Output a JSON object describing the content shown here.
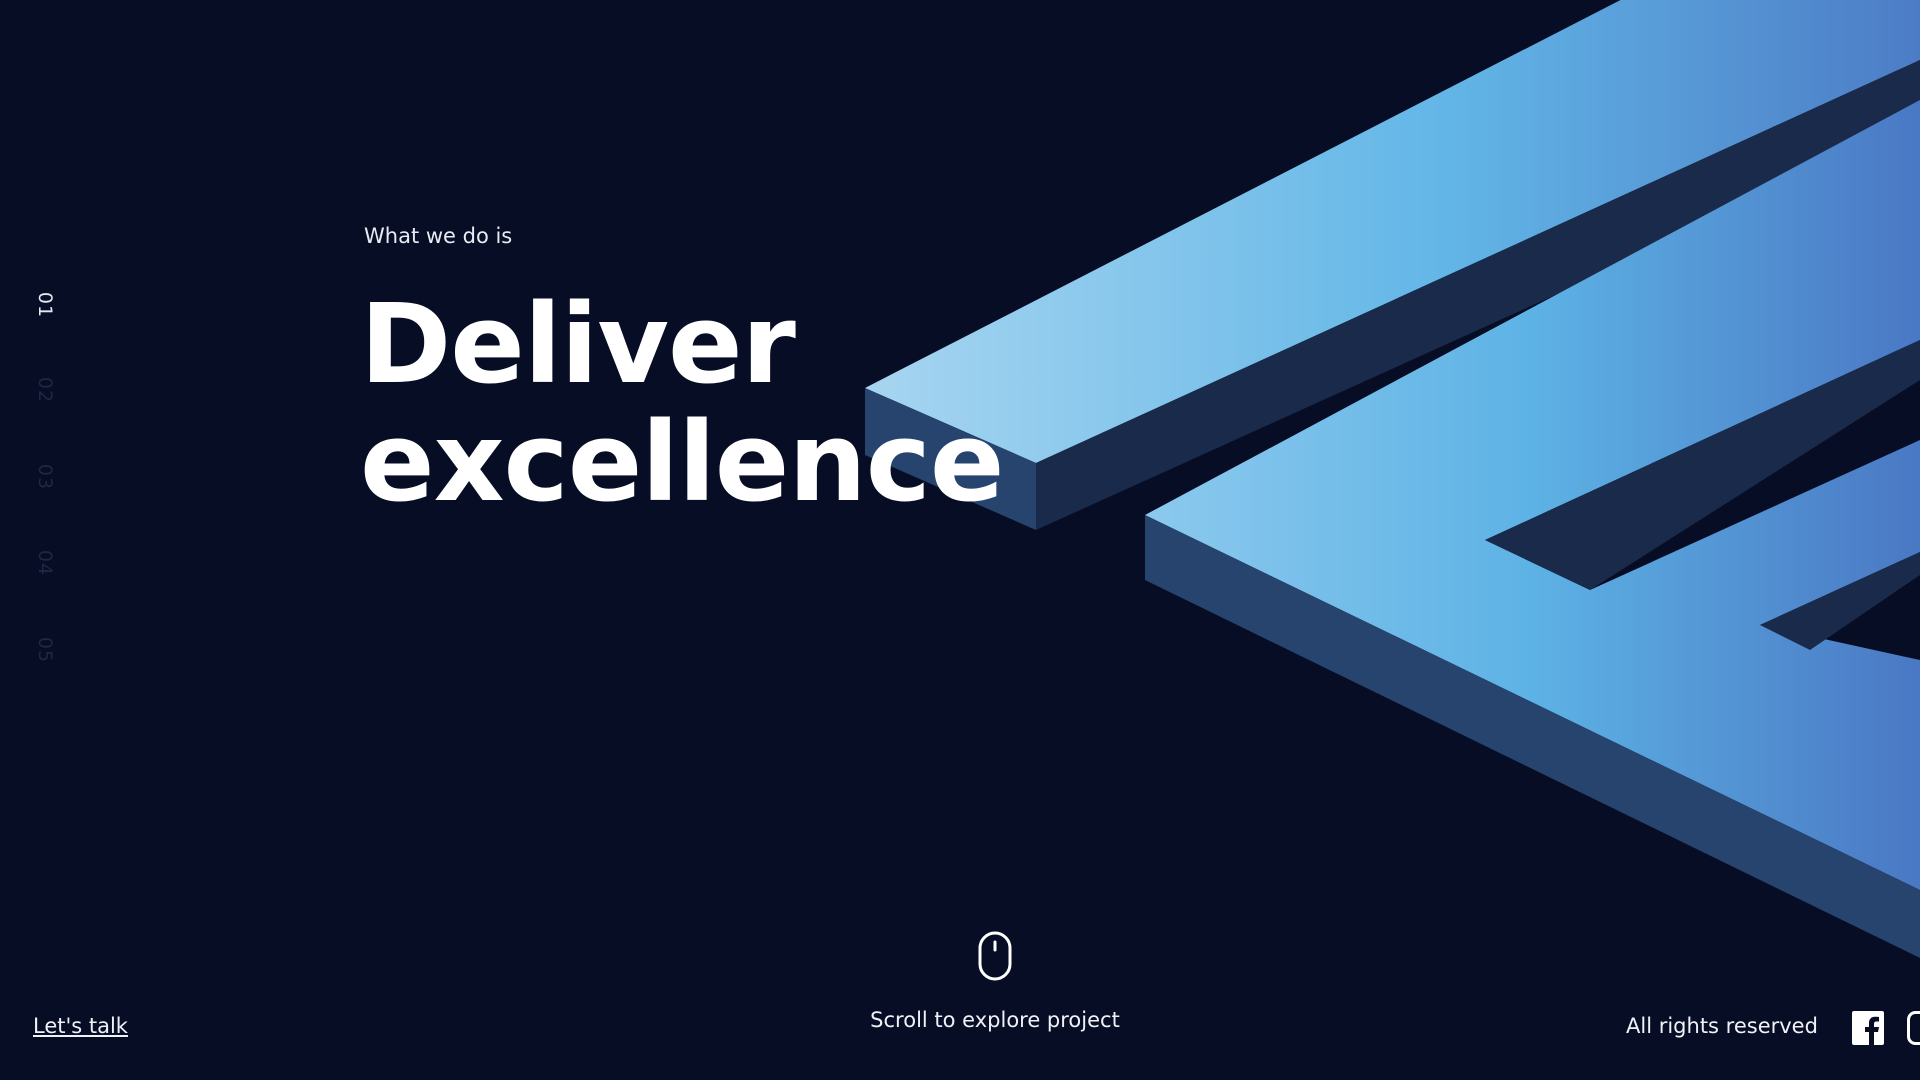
{
  "hero": {
    "eyebrow": "What we do is",
    "headline_line1": "Deliver",
    "headline_line2": "excellence"
  },
  "side_nav": {
    "items": [
      "01",
      "02",
      "03",
      "04",
      "05"
    ],
    "active_index": 0
  },
  "footer": {
    "cta_label": "Let's talk",
    "scroll_label": "Scroll to explore project",
    "rights_label": "All rights reserved",
    "social_icons": [
      "facebook-icon"
    ]
  },
  "colors": {
    "background": "#070d24",
    "shape_light": "#a7d5f0",
    "shape_mid": "#5fb4e6",
    "shape_dark": "#4a78c4",
    "shape_side": "#26446e",
    "shape_shadow": "#1a2a4a",
    "text": "#ffffff",
    "nav_inactive": "#1e2744"
  }
}
